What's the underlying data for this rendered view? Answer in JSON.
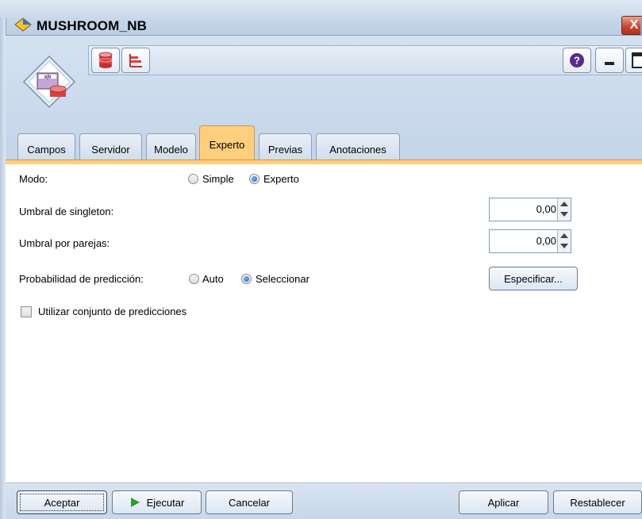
{
  "window": {
    "title": "MUSHROOM_NB",
    "close_label": "X"
  },
  "toolbar": {
    "node_icon": "data-table-node-icon",
    "left_buttons": [
      {
        "icon": "database-icon"
      },
      {
        "icon": "bar-chart-icon"
      }
    ],
    "right_buttons": [
      {
        "icon": "help-icon"
      },
      {
        "icon": "minimize-icon"
      },
      {
        "icon": "maximize-icon"
      }
    ]
  },
  "tabs": [
    {
      "label": "Campos"
    },
    {
      "label": "Servidor"
    },
    {
      "label": "Modelo"
    },
    {
      "label": "Experto",
      "active": true
    },
    {
      "label": "Previas"
    },
    {
      "label": "Anotaciones"
    }
  ],
  "form": {
    "mode": {
      "label": "Modo:",
      "options": [
        "Simple",
        "Experto"
      ],
      "selected": "Experto"
    },
    "singleton": {
      "label": "Umbral de singleton:",
      "value": "0,00"
    },
    "pairwise": {
      "label": "Umbral por parejas:",
      "value": "0,00"
    },
    "prediction": {
      "label": "Probabilidad de predicción:",
      "options": [
        "Auto",
        "Seleccionar"
      ],
      "selected": "Seleccionar",
      "specify_label": "Especificar..."
    },
    "use_prediction_set": {
      "label": "Utilizar conjunto de predicciones",
      "checked": false
    }
  },
  "buttons": {
    "accept": "Aceptar",
    "run": "Ejecutar",
    "cancel": "Cancelar",
    "apply": "Aplicar",
    "reset": "Restablecer"
  },
  "colors": {
    "active_tab": "#ffcf7e",
    "chrome": "#c7d7ea",
    "run_arrow": "#2e9e2e"
  }
}
